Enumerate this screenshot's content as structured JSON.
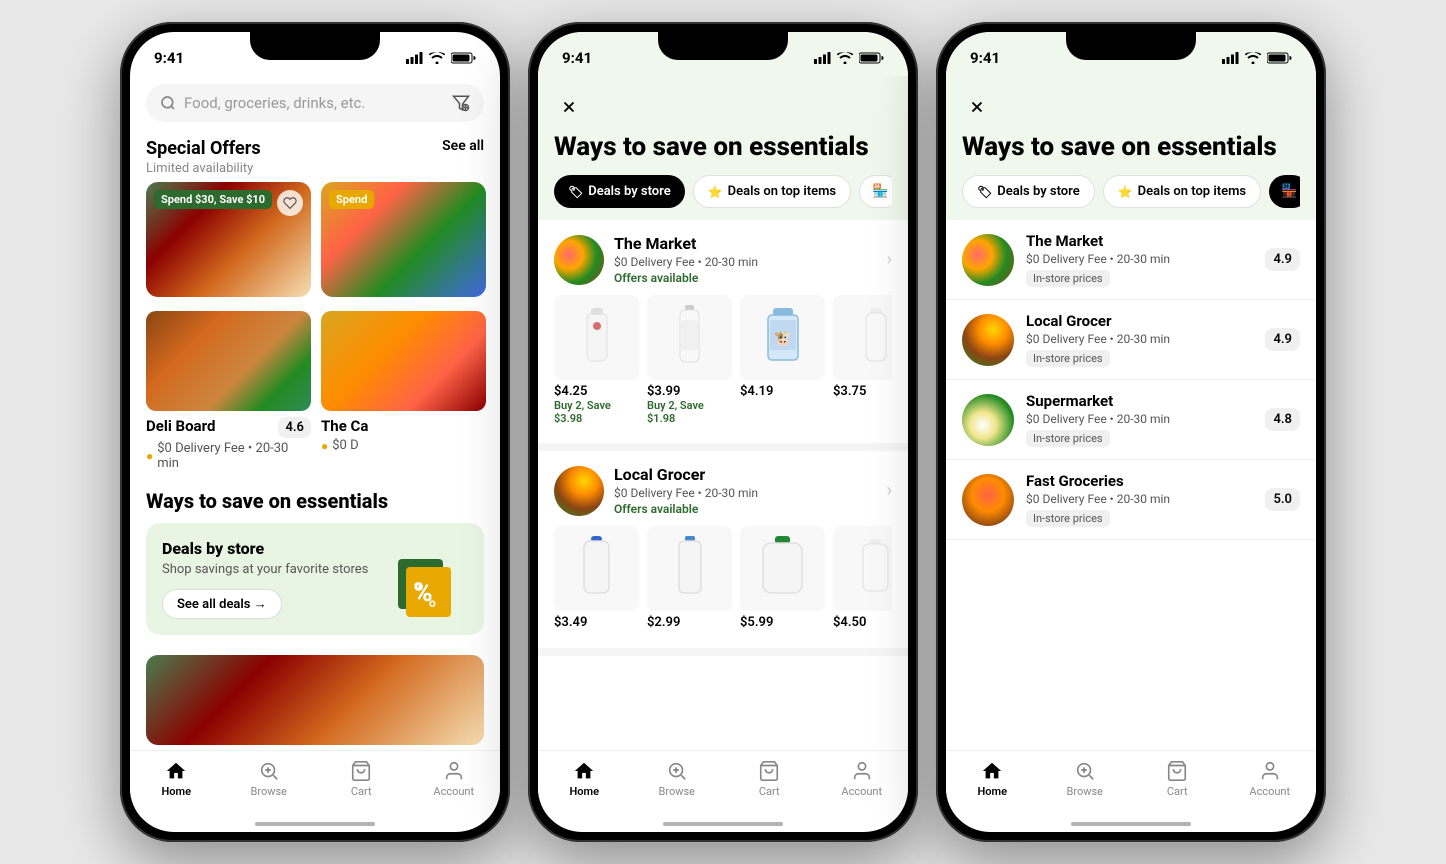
{
  "phones": [
    {
      "id": "phone1",
      "statusBar": {
        "time": "9:41",
        "showIcons": true
      },
      "search": {
        "placeholder": "Food, groceries, drinks, etc."
      },
      "specialOffers": {
        "title": "Special Offers",
        "subtitle": "Limited availability",
        "seeAll": "See all",
        "offers": [
          {
            "badge": "Spend $30, Save $10",
            "hasHeart": true
          },
          {
            "badge": "Spend",
            "hasHeart": false
          }
        ]
      },
      "restaurants": [
        {
          "name": "Deli Board",
          "rating": "4.6",
          "meta": "$0 Delivery Fee • 20-30 min",
          "hasDashPass": true
        },
        {
          "name": "The Ca",
          "rating": "",
          "meta": "$0 D",
          "hasDashPass": true
        }
      ],
      "waysToSave": {
        "title": "Ways to save on essentials",
        "dealsTitle": "Deals by store",
        "dealsDesc": "Shop savings at your favorite stores",
        "seeAllDeals": "See all deals →"
      },
      "nav": {
        "items": [
          {
            "label": "Home",
            "active": true,
            "icon": "home"
          },
          {
            "label": "Browse",
            "active": false,
            "icon": "browse"
          },
          {
            "label": "Cart",
            "active": false,
            "icon": "cart"
          },
          {
            "label": "Account",
            "active": false,
            "icon": "account"
          }
        ]
      }
    },
    {
      "id": "phone2",
      "statusBar": {
        "time": "9:41",
        "showIcons": true
      },
      "closeBtn": "×",
      "title": "Ways to save on essentials",
      "filterTabs": [
        {
          "label": "Deals by store",
          "icon": "tag",
          "active": true
        },
        {
          "label": "Deals on top items",
          "icon": "star",
          "active": false
        },
        {
          "label": "🏪",
          "icon": "store",
          "active": false
        }
      ],
      "stores": [
        {
          "name": "The Market",
          "meta": "$0 Delivery Fee • 20-30 min",
          "offersAvailable": "Offers available",
          "products": [
            {
              "emoji": "🥛",
              "price": "$4.25",
              "deal": "Buy 2, Save $3.98"
            },
            {
              "emoji": "🍼",
              "price": "$3.99",
              "deal": "Buy 2, Save $1.98"
            },
            {
              "emoji": "🥛",
              "price": "$4.19",
              "deal": ""
            },
            {
              "emoji": "🥛",
              "price": "$3.75",
              "deal": ""
            }
          ]
        },
        {
          "name": "Local Grocer",
          "meta": "$0 Delivery Fee • 20-30 min",
          "offersAvailable": "Offers available",
          "products": [
            {
              "emoji": "🥛",
              "price": "$3.49",
              "deal": ""
            },
            {
              "emoji": "🥛",
              "price": "$2.99",
              "deal": ""
            },
            {
              "emoji": "🥛",
              "price": "$5.99",
              "deal": ""
            },
            {
              "emoji": "🥛",
              "price": "$4.50",
              "deal": ""
            }
          ]
        }
      ],
      "nav": {
        "items": [
          {
            "label": "Home",
            "active": true,
            "icon": "home"
          },
          {
            "label": "Browse",
            "active": false,
            "icon": "browse"
          },
          {
            "label": "Cart",
            "active": false,
            "icon": "cart"
          },
          {
            "label": "Account",
            "active": false,
            "icon": "account"
          }
        ]
      }
    },
    {
      "id": "phone3",
      "statusBar": {
        "time": "9:41",
        "showIcons": true
      },
      "closeBtn": "×",
      "title": "Ways to save on essentials",
      "filterTabs": [
        {
          "label": "Deals by store",
          "icon": "tag",
          "active": false
        },
        {
          "label": "Deals on top items",
          "icon": "star",
          "active": false
        },
        {
          "label": "🏪",
          "icon": "store",
          "active": true
        }
      ],
      "storeList": [
        {
          "name": "The Market",
          "meta": "$0 Delivery Fee • 20-30 min",
          "badge": "In-store prices",
          "rating": "4.9",
          "imgClass": "img-market"
        },
        {
          "name": "Local Grocer",
          "meta": "$0 Delivery Fee • 20-30 min",
          "badge": "In-store prices",
          "rating": "4.9",
          "imgClass": "img-grocer"
        },
        {
          "name": "Supermarket",
          "meta": "$0 Delivery Fee • 20-30 min",
          "badge": "In-store prices",
          "rating": "4.8",
          "imgClass": "img-supermarket"
        },
        {
          "name": "Fast Groceries",
          "meta": "$0 Delivery Fee • 20-30 min",
          "badge": "In-store prices",
          "rating": "5.0",
          "imgClass": "img-fast"
        }
      ],
      "nav": {
        "items": [
          {
            "label": "Home",
            "active": true,
            "icon": "home"
          },
          {
            "label": "Browse",
            "active": false,
            "icon": "browse"
          },
          {
            "label": "Cart",
            "active": false,
            "icon": "cart"
          },
          {
            "label": "Account",
            "active": false,
            "icon": "account"
          }
        ]
      }
    }
  ]
}
